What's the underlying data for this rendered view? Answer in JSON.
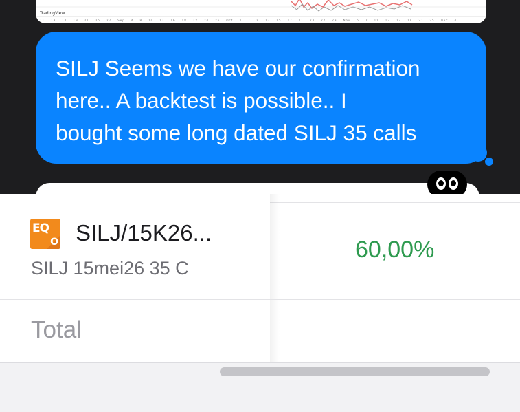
{
  "chat": {
    "chart_attribution": "TradingView",
    "message_text": "SILJ Seems we have our confirmation here.. A backtest is possible.. I bought some long dated SILJ 35 calls",
    "message_lines": [
      "SILJ Seems we have our confirmation",
      "here.. A backtest is possible.. I",
      "bought some long dated SILJ 35 calls"
    ],
    "reaction_emoji": "eyes"
  },
  "positions": {
    "rows": [
      {
        "badge_main": "EQ",
        "badge_sub": "O",
        "symbol": "SILJ/15K26...",
        "description": "SILJ 15mei26 35 C",
        "percentage": "60,00%"
      }
    ],
    "total_label": "Total"
  },
  "colors": {
    "message_bubble": "#0a84ff",
    "percentage_positive": "#2e9a4f",
    "badge": "#f28a1c"
  }
}
